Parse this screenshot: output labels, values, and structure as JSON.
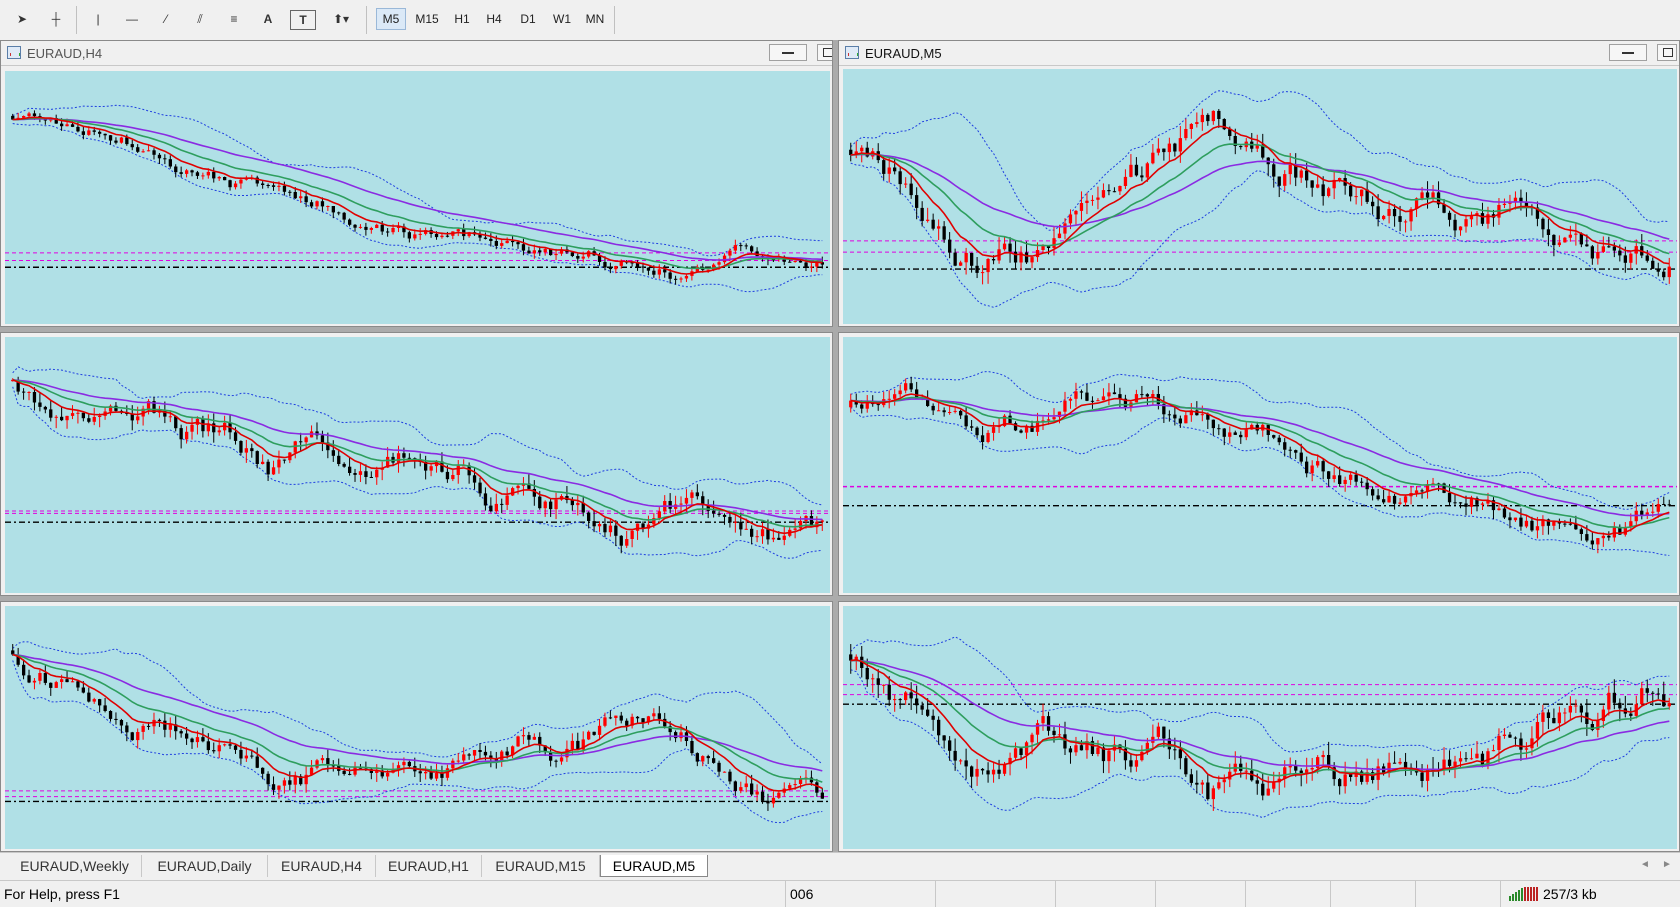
{
  "toolbar": {
    "tools": [
      {
        "name": "cursor-arrow-icon",
        "glyph": "➤"
      },
      {
        "name": "crosshair-icon",
        "glyph": "┼"
      },
      {
        "name": "vertical-line-icon",
        "glyph": "|"
      },
      {
        "name": "horizontal-line-icon",
        "glyph": "—"
      },
      {
        "name": "trend-line-icon",
        "glyph": "⁄"
      },
      {
        "name": "equidistant-channel-icon",
        "glyph": "⫽"
      },
      {
        "name": "fibonacci-retracement-icon",
        "glyph": "≡"
      },
      {
        "name": "text-icon",
        "glyph": "A"
      },
      {
        "name": "text-label-icon",
        "glyph": "T"
      },
      {
        "name": "arrows-dropdown-icon",
        "glyph": "⬆▾"
      }
    ],
    "timeframes": [
      "M5",
      "M15",
      "H1",
      "H4",
      "D1",
      "W1",
      "MN"
    ],
    "active_timeframe": "M5"
  },
  "windows": {
    "top_left_title": "EURAUD,H4",
    "top_right_title": "EURAUD,M5"
  },
  "tabs": [
    "EURAUD,Weekly",
    "EURAUD,Daily",
    "EURAUD,H4",
    "EURAUD,H1",
    "EURAUD,M15",
    "EURAUD,M5"
  ],
  "active_tab": "EURAUD,M5",
  "status": {
    "help": "For Help, press F1",
    "profile": "006",
    "traffic": "257/3 kb"
  },
  "colors": {
    "chart_background": "#b0e0e6",
    "bull_candle": "#ff0000",
    "bear_candle": "#000000",
    "ma_fast": "#e00000",
    "ma_mid": "#2e9e5e",
    "ma_slow": "#8a2be2",
    "bollinger": "#1f3fe0",
    "level_magenta": "#e000e0",
    "level_black": "#000000"
  },
  "charts": [
    {
      "id": "top-left",
      "seed": 11,
      "indicators": [
        "MA fast",
        "MA mid",
        "MA slow",
        "Bollinger Bands"
      ]
    },
    {
      "id": "top-right",
      "seed": 23,
      "indicators": [
        "MA fast",
        "MA mid",
        "MA slow",
        "Bollinger Bands"
      ]
    },
    {
      "id": "mid-left",
      "seed": 37,
      "indicators": [
        "MA fast",
        "MA mid",
        "MA slow",
        "Bollinger Bands"
      ]
    },
    {
      "id": "mid-right",
      "seed": 51,
      "indicators": [
        "MA fast",
        "MA mid",
        "MA slow",
        "Bollinger Bands"
      ]
    },
    {
      "id": "bottom-left",
      "seed": 67,
      "indicators": [
        "MA fast",
        "MA mid",
        "MA slow",
        "Bollinger Bands"
      ]
    },
    {
      "id": "bottom-right",
      "seed": 89,
      "indicators": [
        "MA fast",
        "MA mid",
        "MA slow",
        "Bollinger Bands"
      ]
    }
  ]
}
